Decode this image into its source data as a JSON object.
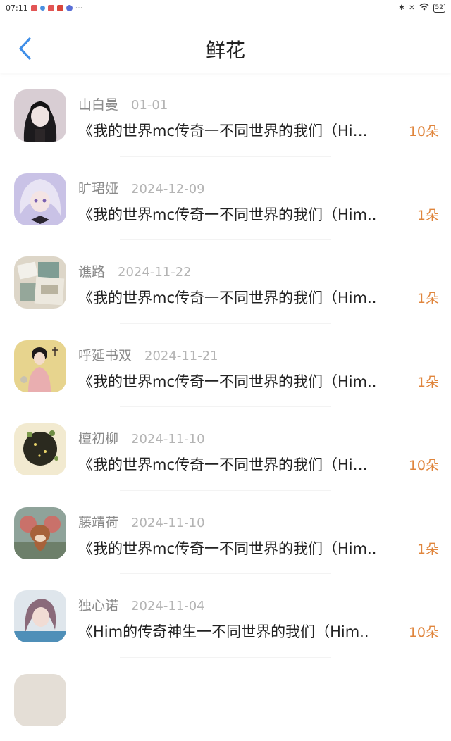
{
  "status_bar": {
    "time": "07:11",
    "battery": "52"
  },
  "header": {
    "title": "鲜花"
  },
  "colors": {
    "accent_back": "#3e8ee8",
    "count": "#e0853c"
  },
  "items": [
    {
      "name": "山白曼",
      "date": "01-01",
      "work": "《我的世界mc传奇一不同世界的我们（Hi…",
      "count": "10朵"
    },
    {
      "name": "旷珺娅",
      "date": "2024-12-09",
      "work": "《我的世界mc传奇一不同世界的我们（Him..",
      "count": "1朵"
    },
    {
      "name": "谯路",
      "date": "2024-11-22",
      "work": "《我的世界mc传奇一不同世界的我们（Him..",
      "count": "1朵"
    },
    {
      "name": "呼延书双",
      "date": "2024-11-21",
      "work": "《我的世界mc传奇一不同世界的我们（Him..",
      "count": "1朵"
    },
    {
      "name": "檀初柳",
      "date": "2024-11-10",
      "work": "《我的世界mc传奇一不同世界的我们（Hi…",
      "count": "10朵"
    },
    {
      "name": "藤靖荷",
      "date": "2024-11-10",
      "work": "《我的世界mc传奇一不同世界的我们（Him..",
      "count": "1朵"
    },
    {
      "name": "独心诺",
      "date": "2024-11-04",
      "work": "《Him的传奇神生一不同世界的我们（Him..",
      "count": "10朵"
    }
  ]
}
